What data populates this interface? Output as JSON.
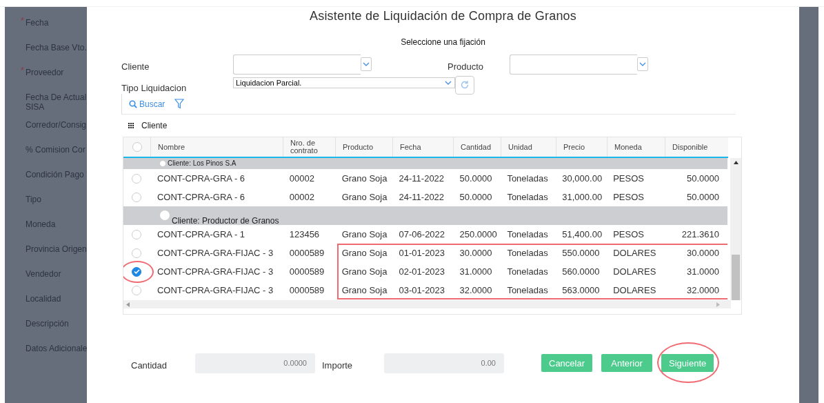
{
  "background_form": {
    "fields": [
      {
        "marker": "*",
        "label": "Fecha"
      },
      {
        "label": "Fecha Base Vto."
      },
      {
        "marker": "*",
        "label": "Proveedor"
      },
      {
        "label": "Fecha De Actual\nSISA"
      },
      {
        "label": "Corredor/Consig"
      },
      {
        "label": "% Comision Cor"
      },
      {
        "label": "Condición Pago"
      },
      {
        "label": "Tipo"
      },
      {
        "label": "Moneda"
      },
      {
        "label": "Provincia Origen"
      },
      {
        "label": "Vendedor"
      },
      {
        "label": "Localidad"
      },
      {
        "label": "Descripción"
      },
      {
        "label": "Datos Adicionale"
      }
    ]
  },
  "dialog": {
    "title": "Asistente de Liquidación de Compra de Granos",
    "subtitle": "Seleccione una fijación",
    "filters": {
      "cliente_label": "Cliente",
      "producto_label": "Producto",
      "tipo_label": "Tipo Liquidacion",
      "tipo_value": "Liquidacion Parcial."
    },
    "toolbar": {
      "search": "Buscar"
    },
    "group_panel": "Cliente",
    "table": {
      "all_selected": false,
      "columns": [
        "Nombre",
        "Nro. de\ncontrato",
        "Producto",
        "Fecha",
        "Cantidad",
        "Unidad",
        "Precio",
        "Moneda",
        "Disponible"
      ],
      "rows": [
        {
          "kind": "group",
          "label": "Cliente: Los Pinos S.A",
          "selected": false
        },
        {
          "kind": "item",
          "selected": false,
          "highlighted": false,
          "circled": false,
          "cells": [
            "CONT-CPRA-GRA - 6",
            "00002",
            "Grano Soja",
            "24-11-2022",
            "50.0000",
            "Toneladas",
            "30,000.00",
            "PESOS",
            "50.0000"
          ]
        },
        {
          "kind": "item",
          "selected": false,
          "highlighted": false,
          "circled": false,
          "cells": [
            "CONT-CPRA-GRA - 6",
            "00002",
            "Grano Soja",
            "24-11-2022",
            "50.0000",
            "Toneladas",
            "31,000.00",
            "PESOS",
            "50.0000"
          ]
        },
        {
          "kind": "group",
          "label": "Cliente: Productor de Granos",
          "selected": false
        },
        {
          "kind": "item",
          "selected": false,
          "highlighted": false,
          "circled": false,
          "cells": [
            "CONT-CPRA-GRA - 1",
            "123456",
            "Grano Soja",
            "07-06-2022",
            "250.0000",
            "Toneladas",
            "51,400.00",
            "PESOS",
            "221.3610"
          ]
        },
        {
          "kind": "item",
          "selected": false,
          "highlighted": true,
          "circled": false,
          "cells": [
            "CONT-CPRA-GRA-FIJAC - 3",
            "0000589",
            "Grano Soja",
            "01-01-2023",
            "30.0000",
            "Toneladas",
            "550.0000",
            "DOLARES",
            "30.0000"
          ]
        },
        {
          "kind": "item",
          "selected": true,
          "highlighted": true,
          "circled": true,
          "cells": [
            "CONT-CPRA-GRA-FIJAC - 3",
            "0000589",
            "Grano Soja",
            "02-01-2023",
            "31.0000",
            "Toneladas",
            "560.0000",
            "DOLARES",
            "31.0000"
          ]
        },
        {
          "kind": "item",
          "selected": false,
          "highlighted": true,
          "circled": false,
          "cells": [
            "CONT-CPRA-GRA-FIJAC - 3",
            "0000589",
            "Grano Soja",
            "03-01-2023",
            "32.0000",
            "Toneladas",
            "563.0000",
            "DOLARES",
            "32.0000"
          ]
        }
      ]
    },
    "totals": [
      {
        "label": "Cantidad",
        "value": "0.0000"
      },
      {
        "label": "Importe",
        "value": "0.00"
      }
    ],
    "buttons": [
      {
        "label": "Cancelar",
        "circled": false
      },
      {
        "label": "Anterior",
        "circled": false
      },
      {
        "label": "Siguiente",
        "circled": true
      }
    ]
  }
}
